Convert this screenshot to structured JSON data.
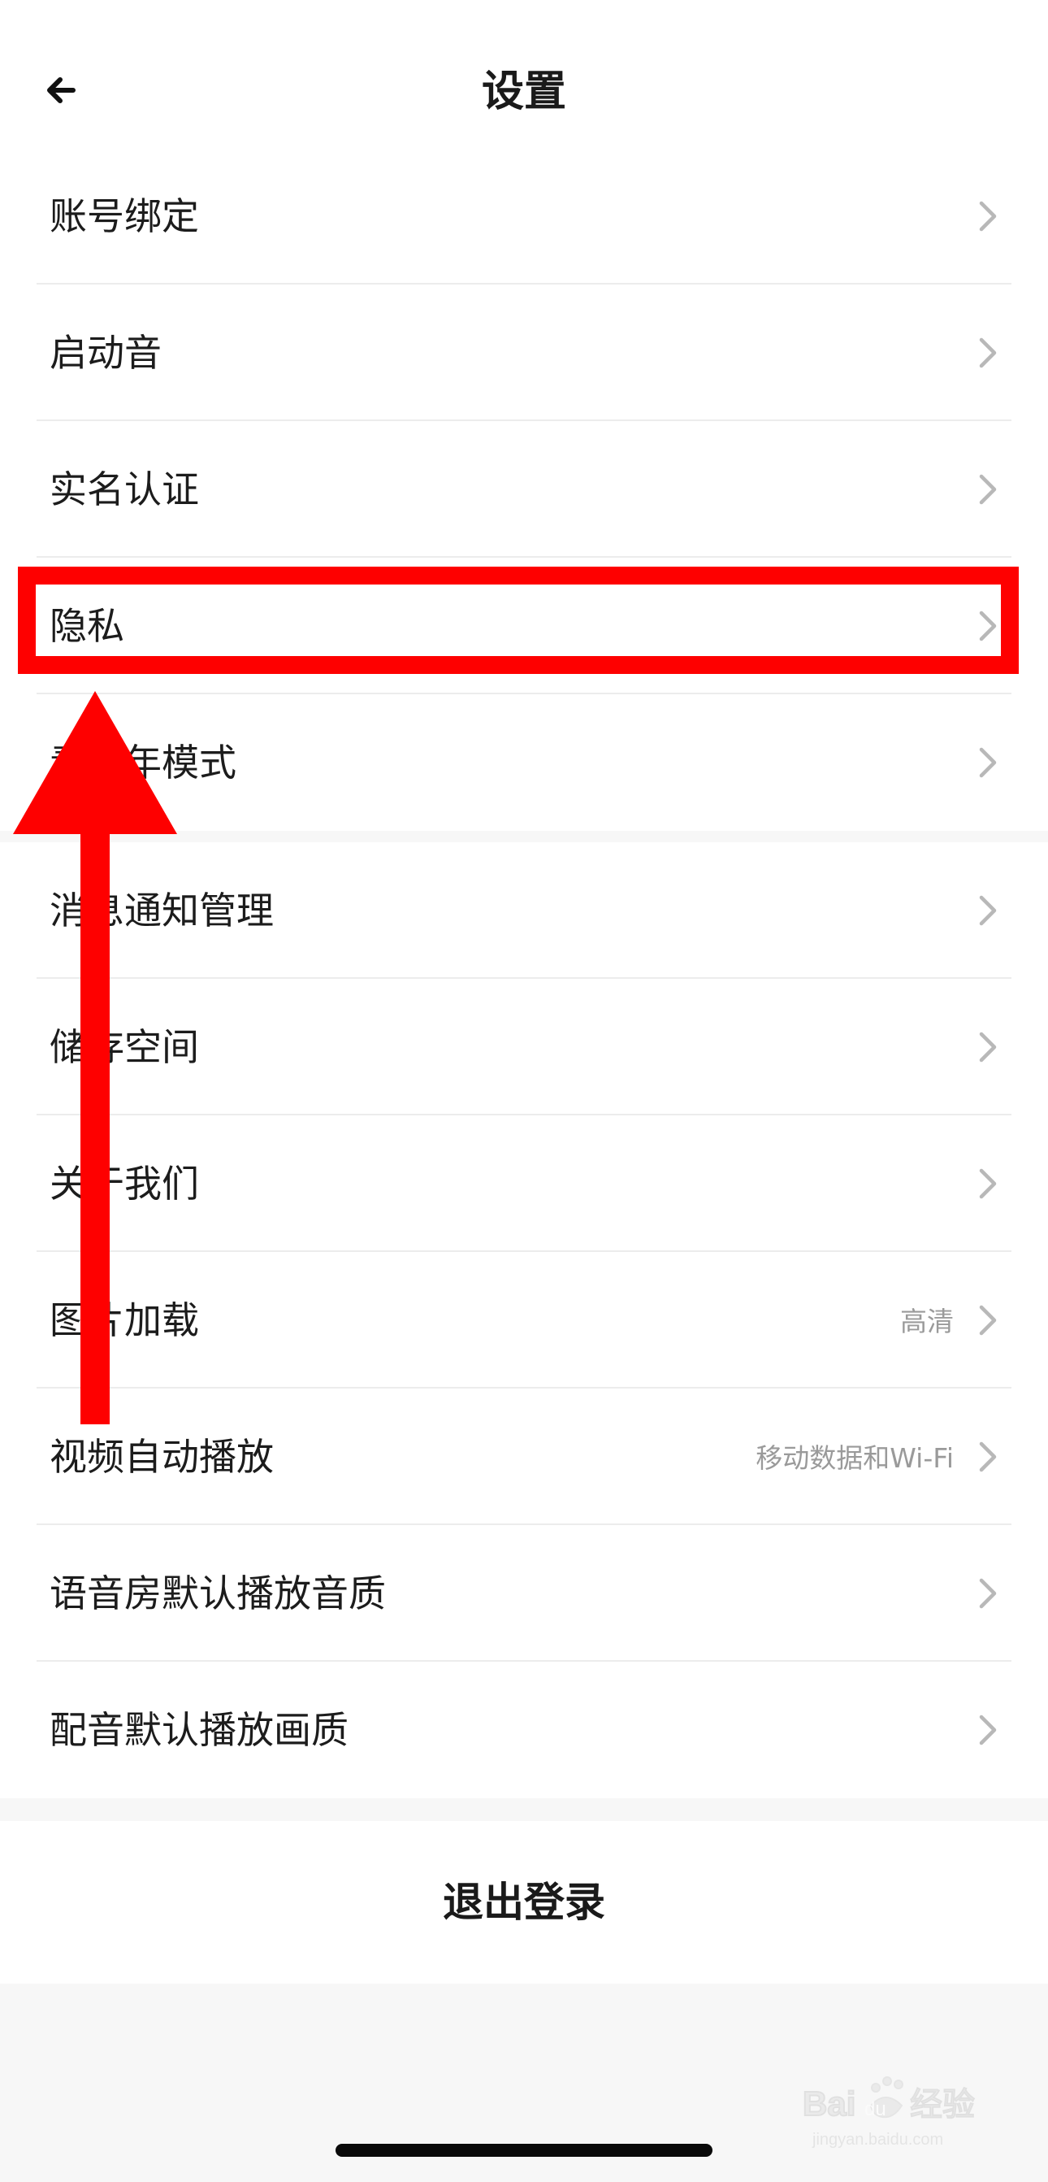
{
  "header": {
    "title": "设置",
    "back_icon": "arrow-left-icon"
  },
  "group1": {
    "items": [
      {
        "label": "账号绑定"
      },
      {
        "label": "启动音"
      },
      {
        "label": "实名认证"
      },
      {
        "label": "隐私"
      },
      {
        "label": "青少年模式"
      }
    ]
  },
  "group2": {
    "items": [
      {
        "label": "消息通知管理",
        "value": ""
      },
      {
        "label": "储存空间",
        "value": ""
      },
      {
        "label": "关于我们",
        "value": ""
      },
      {
        "label": "图片加载",
        "value": "高清"
      },
      {
        "label": "视频自动播放",
        "value": "移动数据和Wi-Fi"
      },
      {
        "label": "语音房默认播放音质",
        "value": ""
      },
      {
        "label": "配音默认播放画质",
        "value": ""
      }
    ]
  },
  "logout": {
    "label": "退出登录"
  },
  "watermark": {
    "brand": "Baidu经验",
    "domain": "jingyan.baidu.com"
  },
  "colors": {
    "annotation": "#fe0000",
    "background": "#f7f7f7",
    "row_bg": "#ffffff",
    "secondary_text": "#9a9a9a"
  }
}
